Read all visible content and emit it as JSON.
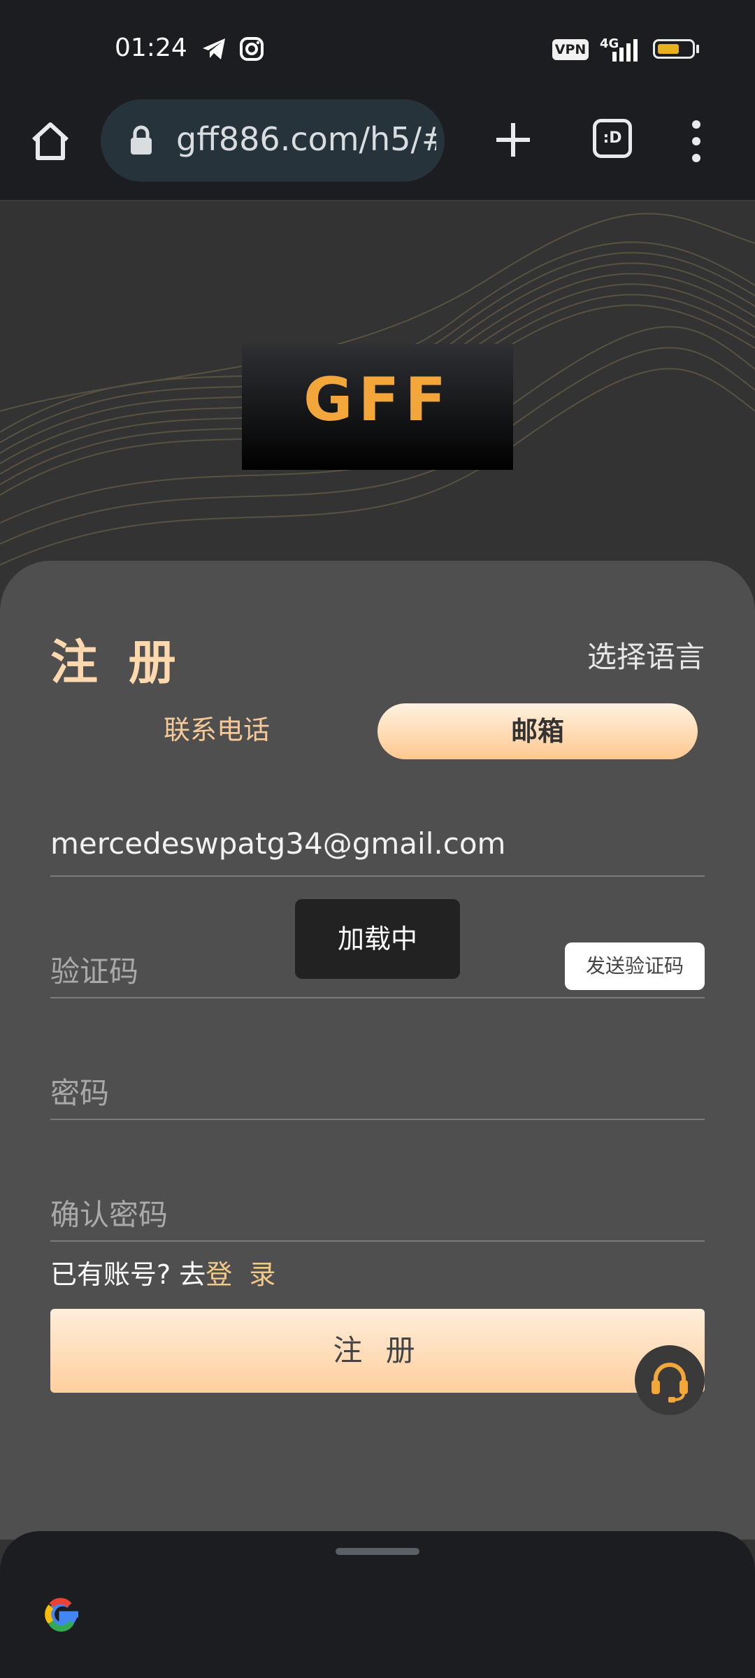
{
  "status_bar": {
    "time": "01:24",
    "icons": [
      "telegram-icon",
      "instagram-icon"
    ],
    "vpn": "VPN",
    "network": "4G"
  },
  "browser": {
    "url": "gff886.com/h5/#",
    "tab_count": ":D"
  },
  "hero": {
    "logo_text": "GFF",
    "accent": "#f3a63a"
  },
  "form": {
    "title": "注 册",
    "language_label": "选择语言",
    "tabs": [
      {
        "label": "联系电话",
        "active": false
      },
      {
        "label": "邮箱",
        "active": true
      }
    ],
    "email_value": "mercedeswpatg34@gmail.com",
    "code_placeholder": "验证码",
    "send_code_label": "发送验证码",
    "password_placeholder": "密码",
    "confirm_password_placeholder": "确认密码",
    "has_account_prefix": "已有账号? 去",
    "login_label": "登 录",
    "register_label": "注 册"
  },
  "toast": {
    "text": "加载中"
  },
  "colors": {
    "card_bg": "#4f4f4f",
    "button_gradient_start": "#ffeddb",
    "button_gradient_end": "#ffcf9e",
    "title_color": "#ffd9ad"
  }
}
